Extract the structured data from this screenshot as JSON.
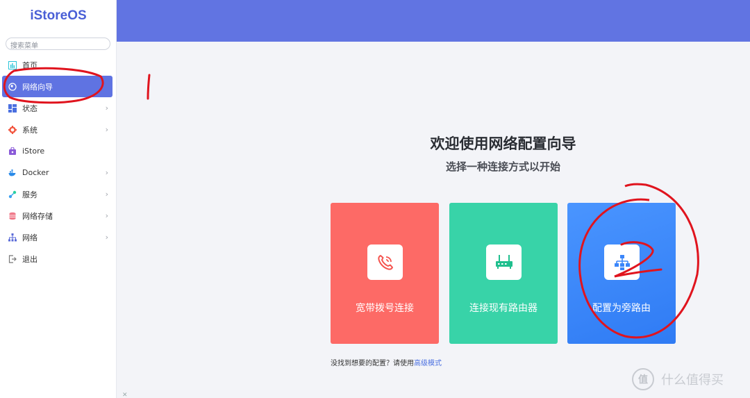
{
  "app": {
    "logo": "iStoreOS"
  },
  "sidebar": {
    "search_placeholder": "搜索菜单",
    "items": [
      {
        "label": "首页",
        "icon": "dashboard-icon",
        "icon_color": "#28c4d8",
        "has_children": false,
        "active": false
      },
      {
        "label": "网络向导",
        "icon": "globe-icon",
        "icon_color": "#ffffff",
        "has_children": false,
        "active": true
      },
      {
        "label": "状态",
        "icon": "grid-icon",
        "icon_color": "#4a6fe0",
        "has_children": true,
        "active": false
      },
      {
        "label": "系统",
        "icon": "gear-icon",
        "icon_color": "#f2553e",
        "has_children": true,
        "active": false
      },
      {
        "label": "iStore",
        "icon": "store-icon",
        "icon_color": "#8a5ad8",
        "has_children": false,
        "active": false
      },
      {
        "label": "Docker",
        "icon": "docker-icon",
        "icon_color": "#2a8ae8",
        "has_children": true,
        "active": false
      },
      {
        "label": "服务",
        "icon": "services-icon",
        "icon_color": "#3aa0f0",
        "has_children": true,
        "active": false
      },
      {
        "label": "网络存储",
        "icon": "storage-icon",
        "icon_color": "#f07a8a",
        "has_children": true,
        "active": false
      },
      {
        "label": "网络",
        "icon": "network-icon",
        "icon_color": "#5a6ad8",
        "has_children": true,
        "active": false
      },
      {
        "label": "退出",
        "icon": "logout-icon",
        "icon_color": "#777777",
        "has_children": false,
        "active": false
      }
    ]
  },
  "main": {
    "title": "欢迎使用网络配置向导",
    "subtitle": "选择一种连接方式以开始",
    "options": [
      {
        "label": "宽带拨号连接",
        "icon": "phone-icon",
        "color": "#fd6a66"
      },
      {
        "label": "连接现有路由器",
        "icon": "router-icon",
        "color": "#38d3a8"
      },
      {
        "label": "配置为旁路由",
        "icon": "topology-icon",
        "color": "#3b86fa"
      }
    ],
    "footer_text": "没找到想要的配置？请使用",
    "footer_link": "高级模式"
  },
  "watermark": {
    "badge": "值",
    "text": "什么值得买"
  },
  "annotations": {
    "mark_1": "1",
    "mark_2": "2",
    "color": "#e0141e"
  }
}
